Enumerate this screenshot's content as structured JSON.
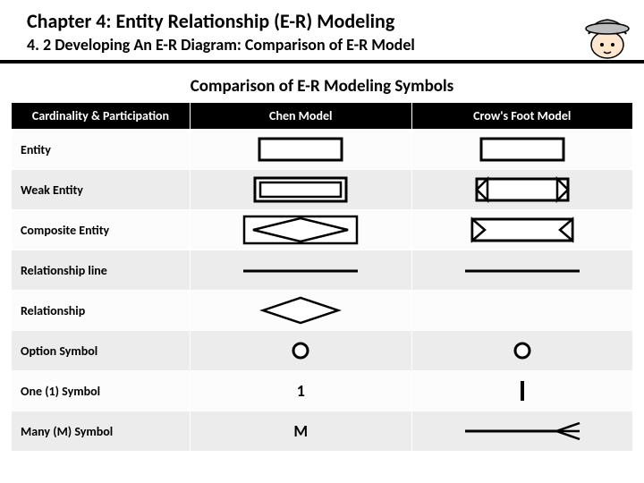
{
  "header": {
    "title": "Chapter 4: Entity Relationship (E-R) Modeling",
    "subtitle": "4. 2 Developing An E-R Diagram: Comparison of E-R Model"
  },
  "table": {
    "title": "Comparison of E-R Modeling Symbols",
    "columns": [
      "Cardinality & Participation",
      "Chen Model",
      "Crow's Foot Model"
    ],
    "rows": [
      {
        "label": "Entity",
        "chen_text": "",
        "crow_text": ""
      },
      {
        "label": "Weak Entity",
        "chen_text": "",
        "crow_text": ""
      },
      {
        "label": "Composite Entity",
        "chen_text": "",
        "crow_text": ""
      },
      {
        "label": "Relationship line",
        "chen_text": "",
        "crow_text": ""
      },
      {
        "label": "Relationship",
        "chen_text": "",
        "crow_text": ""
      },
      {
        "label": "Option Symbol",
        "chen_text": "",
        "crow_text": ""
      },
      {
        "label": "One (1) Symbol",
        "chen_text": "1",
        "crow_text": ""
      },
      {
        "label": "Many (M) Symbol",
        "chen_text": "M",
        "crow_text": ""
      }
    ]
  }
}
